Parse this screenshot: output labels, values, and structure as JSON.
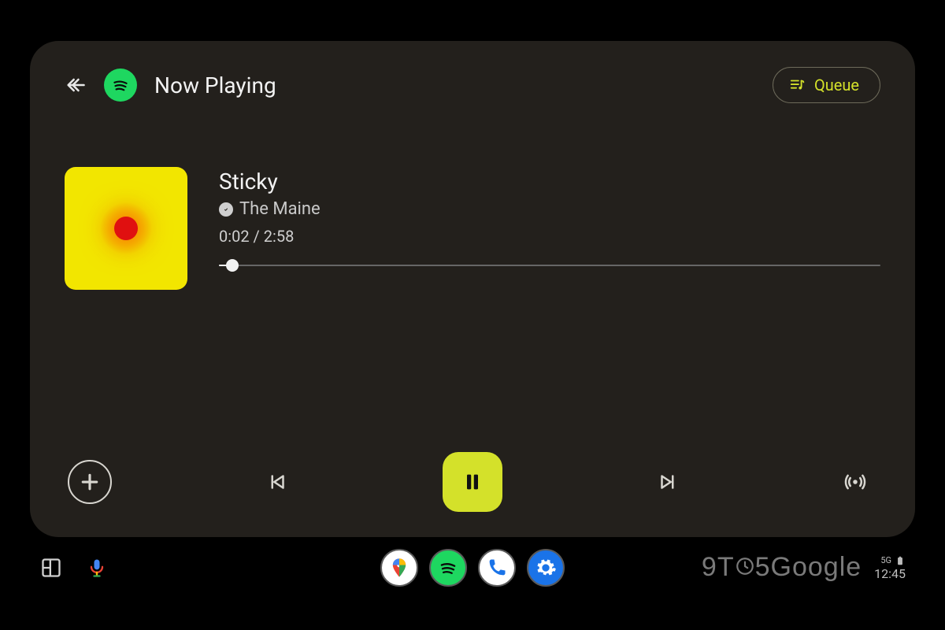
{
  "header": {
    "title": "Now Playing",
    "app_icon": "spotify-icon",
    "queue_label": "Queue"
  },
  "track": {
    "title": "Sticky",
    "artist": "The Maine",
    "current_time": "0:02",
    "duration": "2:58",
    "progress_percent": 2
  },
  "controls": {
    "add": "add-icon",
    "previous": "skip-previous-icon",
    "playpause": "pause-icon",
    "next": "skip-next-icon",
    "broadcast": "broadcast-icon"
  },
  "navbar": {
    "dashboard_icon": "dashboard-icon",
    "voice_icon": "mic-icon",
    "apps": [
      "maps",
      "spotify",
      "phone",
      "settings"
    ]
  },
  "status": {
    "signal": "5G",
    "clock": "12:45"
  },
  "watermark": "9TO5Google",
  "colors": {
    "accent": "#d4e12a",
    "spotify_green": "#1ed760",
    "card_bg": "#23201c"
  }
}
